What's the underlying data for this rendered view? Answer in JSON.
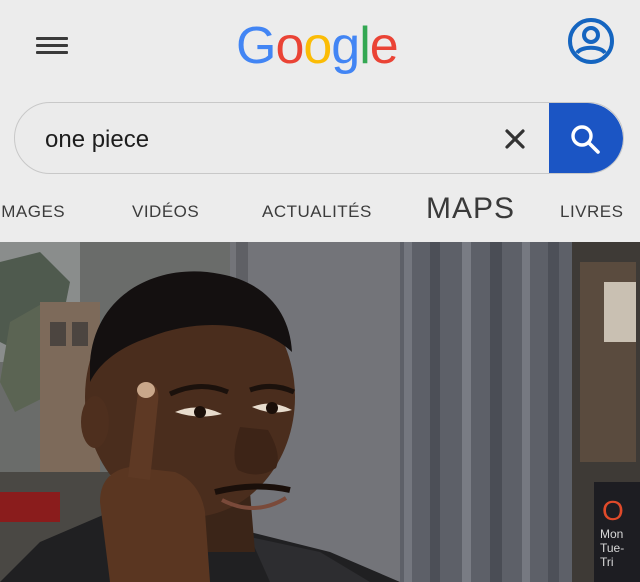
{
  "header": {
    "menu_icon": "hamburger-menu-icon",
    "logo_letters": [
      "G",
      "o",
      "o",
      "g",
      "l",
      "e"
    ],
    "account_icon": "account-circle-icon"
  },
  "search": {
    "value": "one piece",
    "clear_icon": "close-icon",
    "submit_icon": "search-icon",
    "accent_color": "#1b55c4"
  },
  "tabs": [
    {
      "label": "IMAGES"
    },
    {
      "label": "VIDÉOS"
    },
    {
      "label": "ACTUALITÉS"
    },
    {
      "label": "MAPS"
    },
    {
      "label": "LIVRES"
    }
  ],
  "photo": {
    "sign_lines": [
      "O",
      "Mon",
      "Tue-",
      "Tri"
    ]
  }
}
